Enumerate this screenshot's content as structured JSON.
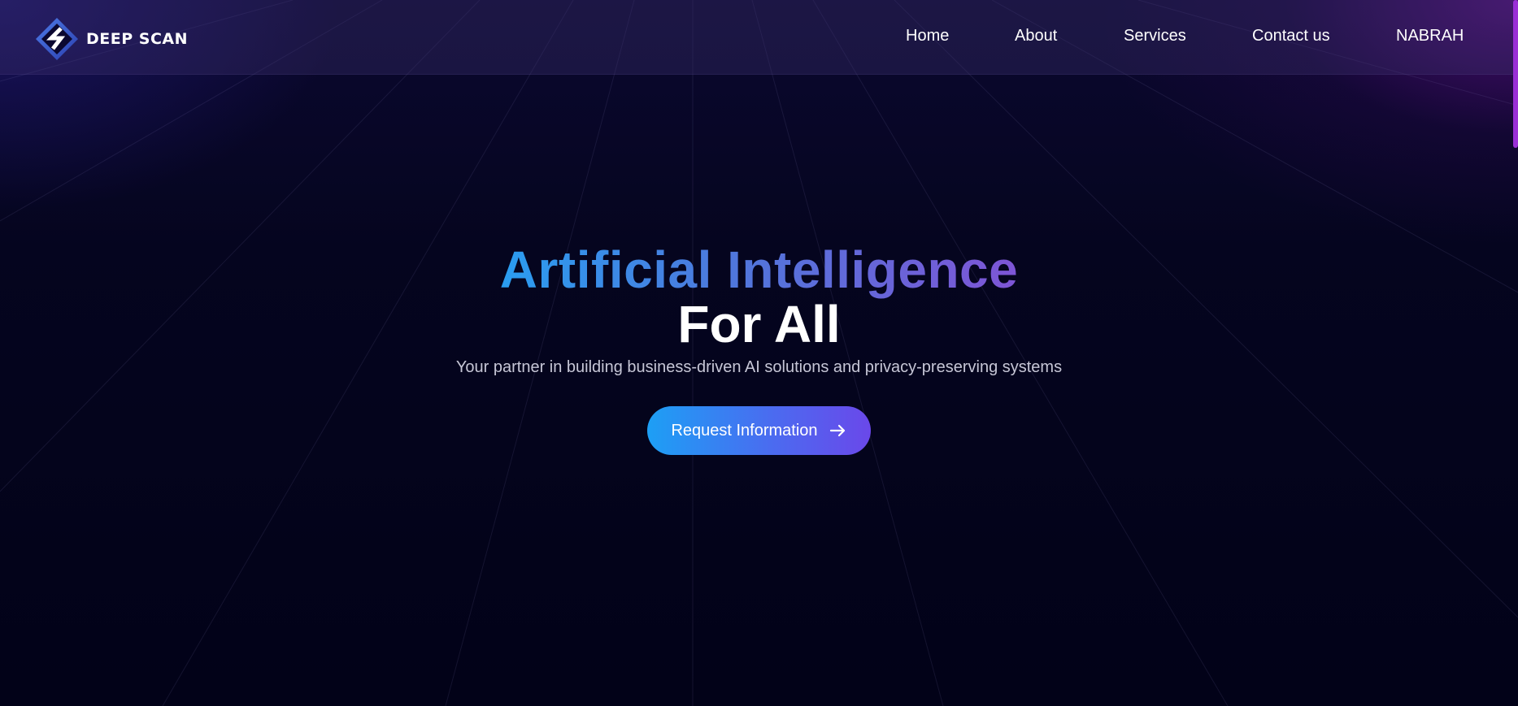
{
  "brand": {
    "name": "DEEP SCAN",
    "logo_icon": "diamond-s-logo-icon"
  },
  "nav": {
    "items": [
      {
        "label": "Home"
      },
      {
        "label": "About"
      },
      {
        "label": "Services"
      },
      {
        "label": "Contact us"
      },
      {
        "label": "NABRAH"
      }
    ]
  },
  "hero": {
    "title_line1": "Artificial Intelligence",
    "title_line2": "For All",
    "subtitle": "Your partner in building business-driven AI solutions and privacy-preserving systems",
    "cta_label": "Request Information",
    "cta_icon": "arrow-right-icon"
  },
  "colors": {
    "background": "#03031a",
    "accent_blue": "#1d9ff5",
    "accent_purple": "#6a48ea",
    "scrollbar": "#9a2fd6"
  }
}
